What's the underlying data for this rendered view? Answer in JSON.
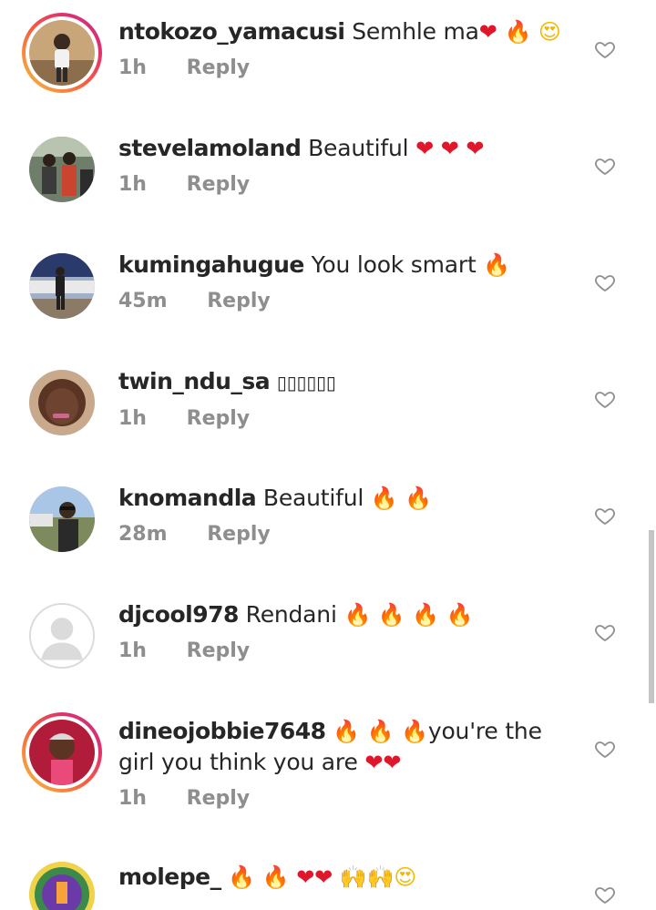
{
  "comments": [
    {
      "username": "ntokozo_yamacusi",
      "text": "Semhle ma",
      "emoji": [
        {
          "char": "❤",
          "kind": "red"
        },
        {
          "char": "🔥",
          "kind": "fire"
        },
        {
          "char": "😍",
          "kind": "yellow"
        }
      ],
      "time": "1h",
      "reply": "Reply",
      "has_story_ring": true
    },
    {
      "username": "stevelamoland",
      "text": "Beautiful ",
      "emoji": [
        {
          "char": "❤",
          "kind": "red"
        },
        {
          "char": "❤",
          "kind": "red"
        },
        {
          "char": "❤",
          "kind": "red"
        }
      ],
      "time": "1h",
      "reply": "Reply",
      "has_story_ring": false
    },
    {
      "username": "kumingahugue",
      "text": "You look smart ",
      "emoji": [
        {
          "char": "🔥",
          "kind": "fire"
        }
      ],
      "time": "45m",
      "reply": "Reply",
      "has_story_ring": false
    },
    {
      "username": "twin_ndu_sa",
      "text": "",
      "emoji": [
        {
          "char": "▯▯▯▯▯▯",
          "kind": "box"
        }
      ],
      "time": "1h",
      "reply": "Reply",
      "has_story_ring": false
    },
    {
      "username": "knomandla",
      "text": "Beautiful ",
      "emoji": [
        {
          "char": "🔥",
          "kind": "fire"
        },
        {
          "char": "🔥",
          "kind": "fire"
        }
      ],
      "time": "28m",
      "reply": "Reply",
      "has_story_ring": false
    },
    {
      "username": "djcool978",
      "text": "Rendani ",
      "emoji": [
        {
          "char": "🔥",
          "kind": "fire"
        },
        {
          "char": "🔥",
          "kind": "fire"
        },
        {
          "char": "🔥",
          "kind": "fire"
        },
        {
          "char": "🔥",
          "kind": "fire"
        }
      ],
      "time": "1h",
      "reply": "Reply",
      "has_story_ring": false
    },
    {
      "username": "dineojobbie7648",
      "text": "you're the girl you think you are",
      "emoji_before": [
        {
          "char": "🔥",
          "kind": "fire"
        },
        {
          "char": "🔥",
          "kind": "fire"
        },
        {
          "char": "🔥",
          "kind": "fire"
        }
      ],
      "emoji": [
        {
          "char": "❤",
          "kind": "red"
        },
        {
          "char": "❤",
          "kind": "red"
        }
      ],
      "time": "1h",
      "reply": "Reply",
      "has_story_ring": true
    },
    {
      "username": "molepe_",
      "text": "",
      "emoji": [
        {
          "char": "🔥",
          "kind": "fire"
        },
        {
          "char": "🔥",
          "kind": "fire"
        },
        {
          "char": "❤",
          "kind": "red"
        },
        {
          "char": "❤",
          "kind": "red"
        },
        {
          "char": "🙌",
          "kind": "yellow"
        },
        {
          "char": "🙌",
          "kind": "yellow"
        },
        {
          "char": "😍",
          "kind": "yellow"
        }
      ],
      "time": "",
      "reply": "",
      "has_story_ring": false
    }
  ],
  "icons": {
    "like": "heart-outline-icon",
    "default_avatar": "default-avatar-icon"
  },
  "colors": {
    "meta_gray": "#8e8e8e",
    "text": "#262626",
    "heart_red": "#e0162b"
  }
}
